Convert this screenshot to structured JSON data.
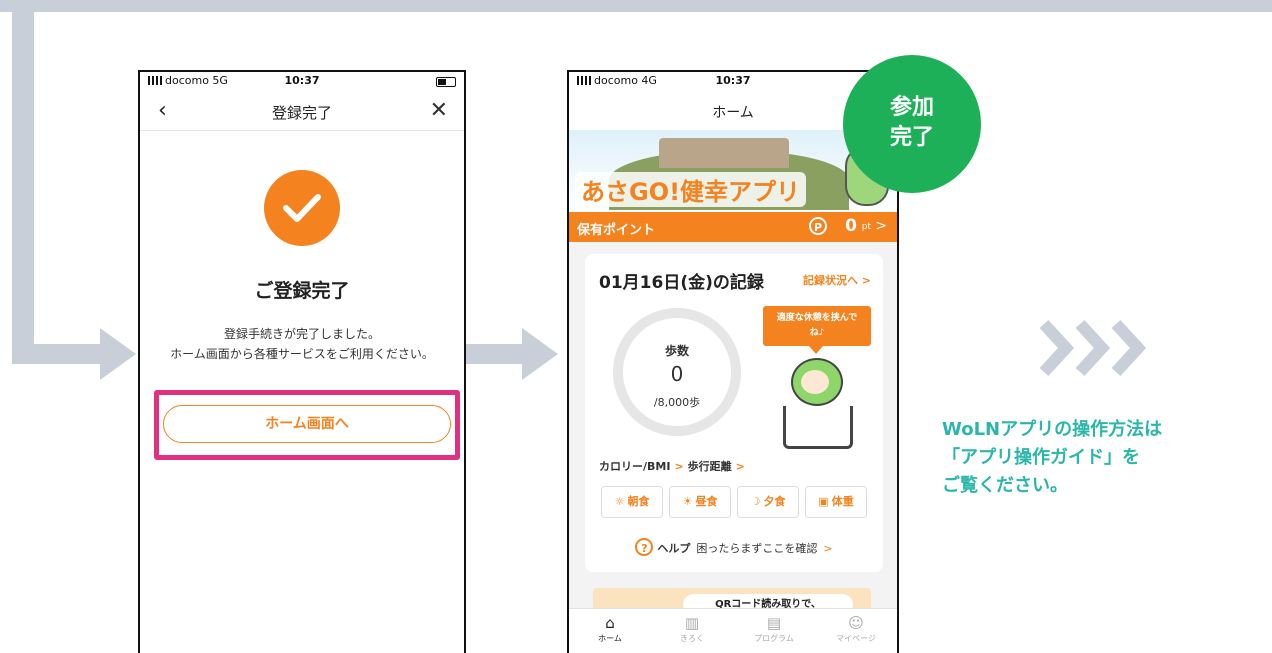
{
  "colors": {
    "accent": "#f4821e",
    "highlight": "#e0307f",
    "badge": "#1db058",
    "guide_text": "#2ab7a9",
    "flow": "#c9cfd8"
  },
  "screen1": {
    "status": {
      "carrier": "docomo 5G",
      "time": "10:37"
    },
    "nav": {
      "back_icon": "chevron-left-icon",
      "title": "登録完了",
      "close_icon": "close-icon"
    },
    "icon": "check-circle-icon",
    "heading": "ご登録完了",
    "message_line1": "登録手続きが完了しました。",
    "message_line2": "ホーム画面から各種サービスをご利用ください。",
    "button": "ホーム画面へ"
  },
  "screen2": {
    "status": {
      "carrier": "docomo 4G",
      "time": "10:37"
    },
    "nav": {
      "title": "ホーム"
    },
    "banner": {
      "logo": "あさGO!健幸アプリ"
    },
    "points": {
      "label": "保有ポイント",
      "badge": "P",
      "value": "0",
      "unit": "pt",
      "chevron": ">"
    },
    "record": {
      "date": "01月16日(金)の記録",
      "link": "記録状況へ >",
      "steps_label": "歩数",
      "steps_value": "0",
      "steps_goal": "/8,000歩",
      "bubble_line1": "適度な休憩を挟んで",
      "bubble_line2": "ね♪",
      "link_calorie": "カロリー/BMI",
      "link_distance": "歩行距離",
      "meals": [
        {
          "icon": "sunrise-icon",
          "glyph": "☼",
          "label": "朝食"
        },
        {
          "icon": "sun-icon",
          "glyph": "☀",
          "label": "昼食"
        },
        {
          "icon": "moon-icon",
          "glyph": "☽",
          "label": "夕食"
        },
        {
          "icon": "scale-icon",
          "glyph": "▣",
          "label": "体重"
        }
      ],
      "help_icon": "?",
      "help_label": "ヘルプ",
      "help_text": "困ったらまずここを確認"
    },
    "qr_promo": "QRコード読み取りで、",
    "tabs": [
      {
        "icon": "home-icon",
        "glyph": "⌂",
        "label": "ホーム",
        "active": true
      },
      {
        "icon": "chart-icon",
        "glyph": "▥",
        "label": "きろく",
        "active": false
      },
      {
        "icon": "program-icon",
        "glyph": "▤",
        "label": "プログラム",
        "active": false
      },
      {
        "icon": "user-icon",
        "glyph": "☺",
        "label": "マイページ",
        "active": false
      }
    ]
  },
  "badge": {
    "line1": "参加",
    "line2": "完了"
  },
  "guide": {
    "line1": "WoLNアプリの操作方法は",
    "line2": "「アプリ操作ガイド」を",
    "line3": "ご覧ください。"
  }
}
